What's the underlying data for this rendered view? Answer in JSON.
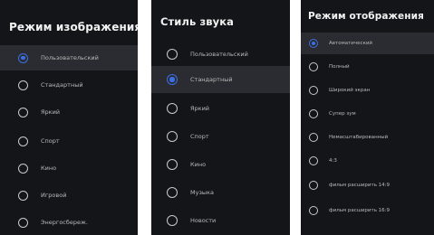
{
  "panels": [
    {
      "title": "Режим изображения",
      "items": [
        "Пользовательский",
        "Стандартный",
        "Яркий",
        "Спорт",
        "Кино",
        "Игровой",
        "Энергосбереж."
      ],
      "checked_index": 0
    },
    {
      "title": "Стиль звука",
      "items": [
        "Пользовательский",
        "Стандартный",
        "Яркий",
        "Спорт",
        "Кино",
        "Музыка",
        "Новости"
      ],
      "checked_index": 1
    },
    {
      "title": "Режим отображения",
      "items": [
        "Автоматический",
        "Полный",
        "Широкий экран",
        "Супер зум",
        "Немасштабированный",
        "4:3",
        "фильм расширить 14:9",
        "фильм расширить 16:9"
      ],
      "checked_index": 0
    }
  ],
  "colors": {
    "panel_bg": "#141519",
    "selected_row_bg": "#2b2c31",
    "accent": "#3b6fe3",
    "title_text": "#f2f2f2",
    "item_text": "#b9b9b9"
  }
}
